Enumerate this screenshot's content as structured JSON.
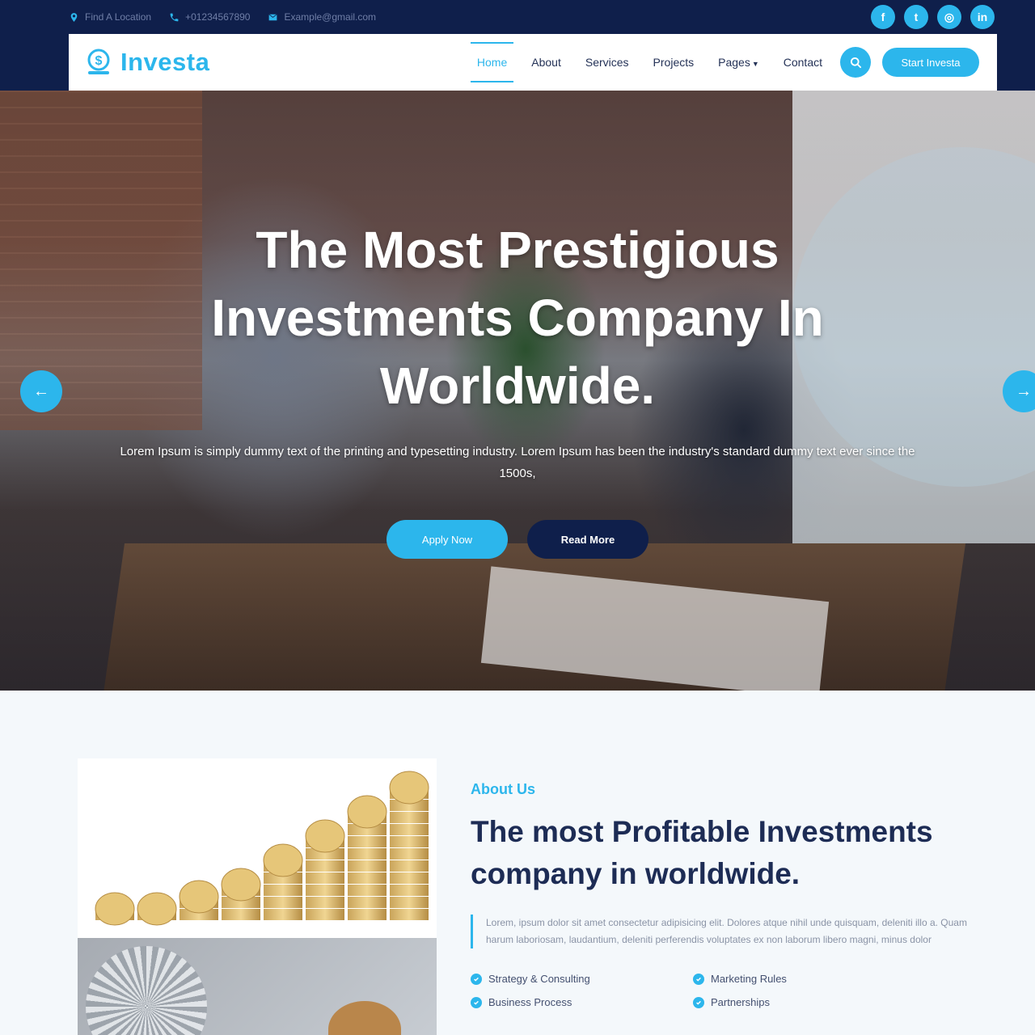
{
  "topbar": {
    "location": "Find A Location",
    "phone": "+01234567890",
    "email": "Example@gmail.com",
    "socials": [
      {
        "icon": "facebook-icon",
        "glyph": "f"
      },
      {
        "icon": "twitter-icon",
        "glyph": "t"
      },
      {
        "icon": "instagram-icon",
        "glyph": "◎"
      },
      {
        "icon": "linkedin-icon",
        "glyph": "in"
      }
    ]
  },
  "nav": {
    "brand": "Investa",
    "menu": [
      "Home",
      "About",
      "Services",
      "Projects",
      "Pages",
      "Contact"
    ],
    "cta": "Start Investa"
  },
  "hero": {
    "title": "The Most Prestigious Investments Company In Worldwide.",
    "subtitle": "Lorem Ipsum is simply dummy text of the printing and typesetting industry. Lorem Ipsum has been the industry's standard dummy text ever since the 1500s,",
    "primary_button": "Apply Now",
    "secondary_button": "Read More",
    "prev_arrow": "←",
    "next_arrow": "→"
  },
  "about": {
    "label": "About Us",
    "title": "The most Profitable Investments company in worldwide.",
    "description": "Lorem, ipsum dolor sit amet consectetur adipisicing elit. Dolores atque nihil unde quisquam, deleniti illo a. Quam harum laboriosam, laudantium, deleniti perferendis voluptates ex non laborum libero magni, minus dolor",
    "features": [
      "Strategy & Consulting",
      "Marketing Rules",
      "Business Process",
      "Partnerships"
    ]
  },
  "colors": {
    "accent": "#2cb6ec",
    "navy": "#0f1f4b",
    "heading": "#1d2c55"
  }
}
